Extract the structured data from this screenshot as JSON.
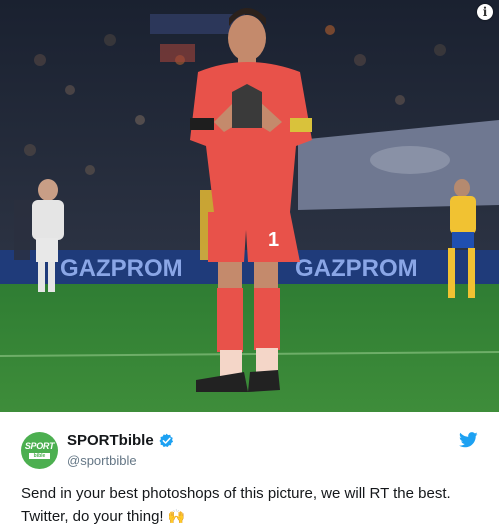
{
  "photo": {
    "alt_subject": "goalkeeper praying hands",
    "shirt_number": "1",
    "ad_board_text": "GAZPROM",
    "colors": {
      "shirt": "#e8524a",
      "pitch": "#2e7d32",
      "away_kit": "#f1c232"
    }
  },
  "tweet": {
    "account_name": "SPORTbible",
    "handle": "@sportbible",
    "avatar_text_top": "SPORT",
    "avatar_text_bottom": "bible",
    "text": "Send in your best photoshops of this picture, we will RT the best. Twitter, do your thing!",
    "emoji": "🙌",
    "verified_icon": "verified-badge-icon",
    "brand_icon": "twitter-bird-icon",
    "colors": {
      "verified": "#1da1f2",
      "bird": "#1da1f2",
      "avatar_bg": "#4caf50"
    }
  },
  "info_label": "i"
}
